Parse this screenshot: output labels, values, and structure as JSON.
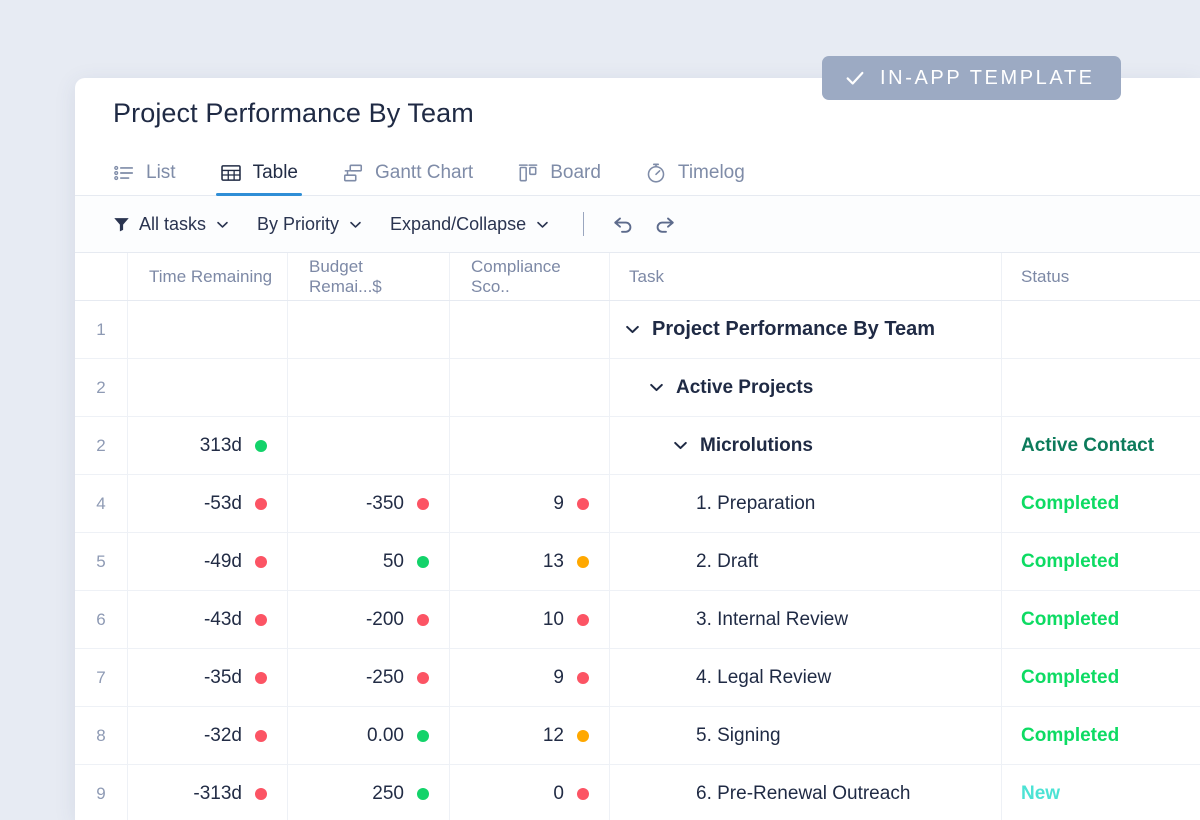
{
  "badge": {
    "label": "IN-APP TEMPLATE",
    "icon": "check-icon",
    "color": "#9caac3"
  },
  "header": {
    "title": "Project Performance By Team"
  },
  "tabs": [
    {
      "label": "List",
      "icon": "list-icon",
      "active": false
    },
    {
      "label": "Table",
      "icon": "table-icon",
      "active": true
    },
    {
      "label": "Gantt Chart",
      "icon": "gantt-icon",
      "active": false
    },
    {
      "label": "Board",
      "icon": "board-icon",
      "active": false
    },
    {
      "label": "Timelog",
      "icon": "stopwatch-icon",
      "active": false
    }
  ],
  "toolbar": {
    "filter_icon": "funnel-icon",
    "items": [
      {
        "label": "All tasks",
        "caret": "chevron-down-icon"
      },
      {
        "label": "By Priority",
        "caret": "chevron-down-icon"
      },
      {
        "label": "Expand/Collapse",
        "caret": "chevron-down-icon"
      }
    ],
    "undo_icon": "undo-icon",
    "redo_icon": "redo-icon"
  },
  "table": {
    "columns": [
      "",
      "Time Remaining",
      "Budget Remai...$",
      "Compliance Sco..",
      "Task",
      "Status"
    ],
    "rows": [
      {
        "num": "1",
        "time": "",
        "time_dot": "",
        "budget": "",
        "budget_dot": "",
        "compliance": "",
        "compliance_dot": "",
        "task": "Project Performance By Team",
        "indent": 0,
        "caret": true,
        "weight": "bold",
        "status": "",
        "status_color": ""
      },
      {
        "num": "2",
        "time": "",
        "time_dot": "",
        "budget": "",
        "budget_dot": "",
        "compliance": "",
        "compliance_dot": "",
        "task": "Active Projects",
        "indent": 1,
        "caret": true,
        "weight": "semi",
        "status": "",
        "status_color": ""
      },
      {
        "num": "2",
        "time": "313d",
        "time_dot": "#13d36a",
        "budget": "",
        "budget_dot": "",
        "compliance": "",
        "compliance_dot": "",
        "task": "Microlutions",
        "indent": 2,
        "caret": true,
        "weight": "semi",
        "status": "Active Contact",
        "status_color": "#0c7b5b"
      },
      {
        "num": "4",
        "time": "-53d",
        "time_dot": "#fc5464",
        "budget": "-350",
        "budget_dot": "#fc5464",
        "compliance": "9",
        "compliance_dot": "#fc5464",
        "task": "1. Preparation",
        "indent": 3,
        "caret": false,
        "weight": "",
        "status": "Completed",
        "status_color": "#0ddb63"
      },
      {
        "num": "5",
        "time": "-49d",
        "time_dot": "#fc5464",
        "budget": "50",
        "budget_dot": "#13d36a",
        "compliance": "13",
        "compliance_dot": "#ffa800",
        "task": "2. Draft",
        "indent": 3,
        "caret": false,
        "weight": "",
        "status": "Completed",
        "status_color": "#0ddb63"
      },
      {
        "num": "6",
        "time": "-43d",
        "time_dot": "#fc5464",
        "budget": "-200",
        "budget_dot": "#fc5464",
        "compliance": "10",
        "compliance_dot": "#fc5464",
        "task": "3. Internal Review",
        "indent": 3,
        "caret": false,
        "weight": "",
        "status": "Completed",
        "status_color": "#0ddb63"
      },
      {
        "num": "7",
        "time": "-35d",
        "time_dot": "#fc5464",
        "budget": "-250",
        "budget_dot": "#fc5464",
        "compliance": "9",
        "compliance_dot": "#fc5464",
        "task": "4. Legal Review",
        "indent": 3,
        "caret": false,
        "weight": "",
        "status": "Completed",
        "status_color": "#0ddb63"
      },
      {
        "num": "8",
        "time": "-32d",
        "time_dot": "#fc5464",
        "budget": "0.00",
        "budget_dot": "#13d36a",
        "compliance": "12",
        "compliance_dot": "#ffa800",
        "task": "5. Signing",
        "indent": 3,
        "caret": false,
        "weight": "",
        "status": "Completed",
        "status_color": "#0ddb63"
      },
      {
        "num": "9",
        "time": "-313d",
        "time_dot": "#fc5464",
        "budget": "250",
        "budget_dot": "#13d36a",
        "compliance": "0",
        "compliance_dot": "#fc5464",
        "task": "6. Pre-Renewal Outreach",
        "indent": 3,
        "caret": false,
        "weight": "",
        "status": "New",
        "status_color": "#4ce3d4"
      }
    ]
  },
  "theme": {
    "page_bg": "#e7ebf3",
    "card_bg": "#ffffff",
    "accent_blue": "#2f8ed6",
    "muted_text": "#7d89a6"
  }
}
